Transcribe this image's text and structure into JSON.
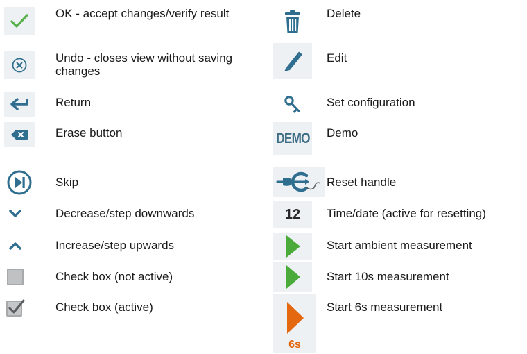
{
  "left": [
    {
      "icon": "checkmark-icon",
      "label": "OK - accept changes/verify result"
    },
    {
      "icon": "undo-circle-x-icon",
      "label": "Undo - closes view without saving changes"
    },
    {
      "icon": "return-arrow-icon",
      "label": "Return"
    },
    {
      "icon": "erase-backspace-icon",
      "label": "Erase button"
    },
    {
      "icon": "skip-icon",
      "label": "Skip"
    },
    {
      "icon": "chevron-down-icon",
      "label": "Decrease/step downwards"
    },
    {
      "icon": "chevron-up-icon",
      "label": "Increase/step upwards"
    },
    {
      "icon": "checkbox-inactive-icon",
      "label": "Check box (not active)"
    },
    {
      "icon": "checkbox-active-icon",
      "label": "Check box (active)"
    }
  ],
  "right": [
    {
      "icon": "trash-icon",
      "label": "Delete"
    },
    {
      "icon": "pencil-icon",
      "label": "Edit"
    },
    {
      "icon": "key-icon",
      "label": "Set configuration"
    },
    {
      "icon": "demo-icon",
      "icon_text": "DEMO",
      "label": "Demo"
    },
    {
      "icon": "reset-handle-icon",
      "label": "Reset handle"
    },
    {
      "icon": "time-date-icon",
      "icon_text": "12",
      "label": "Time/date (active for resetting)"
    },
    {
      "icon": "play-green-icon",
      "label": "Start ambient measurement"
    },
    {
      "icon": "play-green-icon",
      "label": "Start 10s measurement"
    },
    {
      "icon": "play-orange-6s-icon",
      "icon_text": "6s",
      "label": "Start 6s measurement"
    }
  ],
  "colors": {
    "icon_bg": "#eef1f4",
    "teal": "#2f6e8f",
    "green": "#4aab3a",
    "orange": "#e4680f"
  }
}
